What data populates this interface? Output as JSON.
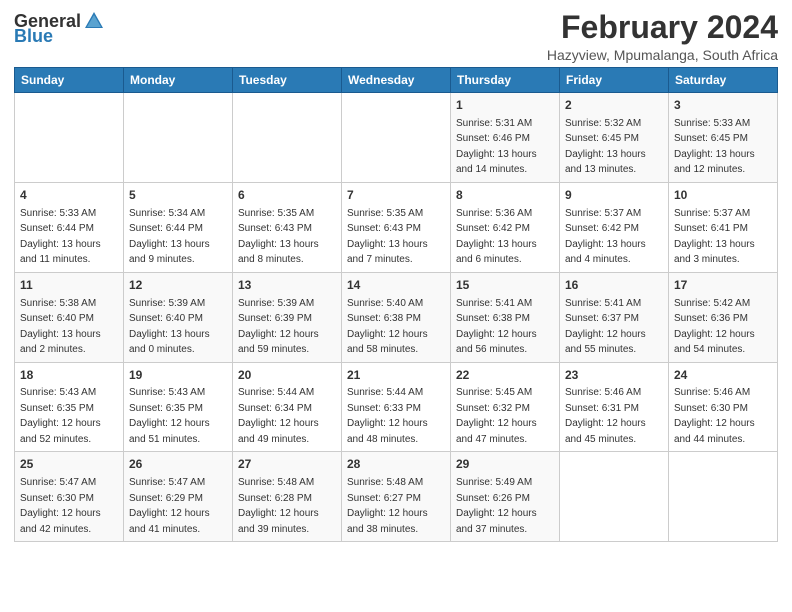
{
  "header": {
    "logo_general": "General",
    "logo_blue": "Blue",
    "title": "February 2024",
    "subtitle": "Hazyview, Mpumalanga, South Africa"
  },
  "days_of_week": [
    "Sunday",
    "Monday",
    "Tuesday",
    "Wednesday",
    "Thursday",
    "Friday",
    "Saturday"
  ],
  "weeks": [
    [
      {
        "day": "",
        "info": ""
      },
      {
        "day": "",
        "info": ""
      },
      {
        "day": "",
        "info": ""
      },
      {
        "day": "",
        "info": ""
      },
      {
        "day": "1",
        "info": "Sunrise: 5:31 AM\nSunset: 6:46 PM\nDaylight: 13 hours\nand 14 minutes."
      },
      {
        "day": "2",
        "info": "Sunrise: 5:32 AM\nSunset: 6:45 PM\nDaylight: 13 hours\nand 13 minutes."
      },
      {
        "day": "3",
        "info": "Sunrise: 5:33 AM\nSunset: 6:45 PM\nDaylight: 13 hours\nand 12 minutes."
      }
    ],
    [
      {
        "day": "4",
        "info": "Sunrise: 5:33 AM\nSunset: 6:44 PM\nDaylight: 13 hours\nand 11 minutes."
      },
      {
        "day": "5",
        "info": "Sunrise: 5:34 AM\nSunset: 6:44 PM\nDaylight: 13 hours\nand 9 minutes."
      },
      {
        "day": "6",
        "info": "Sunrise: 5:35 AM\nSunset: 6:43 PM\nDaylight: 13 hours\nand 8 minutes."
      },
      {
        "day": "7",
        "info": "Sunrise: 5:35 AM\nSunset: 6:43 PM\nDaylight: 13 hours\nand 7 minutes."
      },
      {
        "day": "8",
        "info": "Sunrise: 5:36 AM\nSunset: 6:42 PM\nDaylight: 13 hours\nand 6 minutes."
      },
      {
        "day": "9",
        "info": "Sunrise: 5:37 AM\nSunset: 6:42 PM\nDaylight: 13 hours\nand 4 minutes."
      },
      {
        "day": "10",
        "info": "Sunrise: 5:37 AM\nSunset: 6:41 PM\nDaylight: 13 hours\nand 3 minutes."
      }
    ],
    [
      {
        "day": "11",
        "info": "Sunrise: 5:38 AM\nSunset: 6:40 PM\nDaylight: 13 hours\nand 2 minutes."
      },
      {
        "day": "12",
        "info": "Sunrise: 5:39 AM\nSunset: 6:40 PM\nDaylight: 13 hours\nand 0 minutes."
      },
      {
        "day": "13",
        "info": "Sunrise: 5:39 AM\nSunset: 6:39 PM\nDaylight: 12 hours\nand 59 minutes."
      },
      {
        "day": "14",
        "info": "Sunrise: 5:40 AM\nSunset: 6:38 PM\nDaylight: 12 hours\nand 58 minutes."
      },
      {
        "day": "15",
        "info": "Sunrise: 5:41 AM\nSunset: 6:38 PM\nDaylight: 12 hours\nand 56 minutes."
      },
      {
        "day": "16",
        "info": "Sunrise: 5:41 AM\nSunset: 6:37 PM\nDaylight: 12 hours\nand 55 minutes."
      },
      {
        "day": "17",
        "info": "Sunrise: 5:42 AM\nSunset: 6:36 PM\nDaylight: 12 hours\nand 54 minutes."
      }
    ],
    [
      {
        "day": "18",
        "info": "Sunrise: 5:43 AM\nSunset: 6:35 PM\nDaylight: 12 hours\nand 52 minutes."
      },
      {
        "day": "19",
        "info": "Sunrise: 5:43 AM\nSunset: 6:35 PM\nDaylight: 12 hours\nand 51 minutes."
      },
      {
        "day": "20",
        "info": "Sunrise: 5:44 AM\nSunset: 6:34 PM\nDaylight: 12 hours\nand 49 minutes."
      },
      {
        "day": "21",
        "info": "Sunrise: 5:44 AM\nSunset: 6:33 PM\nDaylight: 12 hours\nand 48 minutes."
      },
      {
        "day": "22",
        "info": "Sunrise: 5:45 AM\nSunset: 6:32 PM\nDaylight: 12 hours\nand 47 minutes."
      },
      {
        "day": "23",
        "info": "Sunrise: 5:46 AM\nSunset: 6:31 PM\nDaylight: 12 hours\nand 45 minutes."
      },
      {
        "day": "24",
        "info": "Sunrise: 5:46 AM\nSunset: 6:30 PM\nDaylight: 12 hours\nand 44 minutes."
      }
    ],
    [
      {
        "day": "25",
        "info": "Sunrise: 5:47 AM\nSunset: 6:30 PM\nDaylight: 12 hours\nand 42 minutes."
      },
      {
        "day": "26",
        "info": "Sunrise: 5:47 AM\nSunset: 6:29 PM\nDaylight: 12 hours\nand 41 minutes."
      },
      {
        "day": "27",
        "info": "Sunrise: 5:48 AM\nSunset: 6:28 PM\nDaylight: 12 hours\nand 39 minutes."
      },
      {
        "day": "28",
        "info": "Sunrise: 5:48 AM\nSunset: 6:27 PM\nDaylight: 12 hours\nand 38 minutes."
      },
      {
        "day": "29",
        "info": "Sunrise: 5:49 AM\nSunset: 6:26 PM\nDaylight: 12 hours\nand 37 minutes."
      },
      {
        "day": "",
        "info": ""
      },
      {
        "day": "",
        "info": ""
      }
    ]
  ]
}
